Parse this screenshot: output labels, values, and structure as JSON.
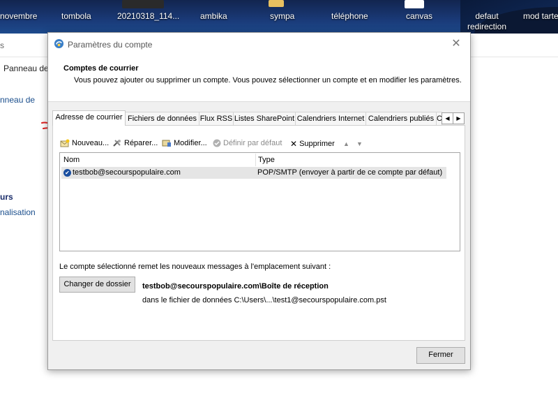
{
  "desktop": {
    "icons": [
      "novembre",
      "tombola",
      "20210318_114...",
      "ambika",
      "sympa",
      "téléphone",
      "canvas",
      "defaut redirection",
      "mod tarteaucit"
    ]
  },
  "background_window": {
    "top_left_fragment": "s",
    "breadcrumb_fragment": "Panneau de",
    "sidebar_fragment_1": "nneau de",
    "sidebar_fragment_2": "urs",
    "sidebar_fragment_3": "nalisation"
  },
  "dialog": {
    "title": "Paramètres du compte",
    "header_title": "Comptes de courrier",
    "header_subtitle": "Vous pouvez ajouter ou supprimer un compte. Vous pouvez sélectionner un compte et en modifier les paramètres.",
    "tabs": [
      "Adresse de courrier",
      "Fichiers de données",
      "Flux RSS",
      "Listes SharePoint",
      "Calendriers Internet",
      "Calendriers publiés",
      "C"
    ],
    "toolbar": {
      "new": "Nouveau...",
      "repair": "Réparer...",
      "modify": "Modifier...",
      "set_default": "Définir par défaut",
      "delete": "Supprimer"
    },
    "list": {
      "col_name": "Nom",
      "col_type": "Type",
      "rows": [
        {
          "name": "testbob@secourspopulaire.com",
          "type": "POP/SMTP (envoyer à partir de ce compte par défaut)"
        }
      ]
    },
    "delivery_info": "Le compte sélectionné remet les nouveaux messages à l'emplacement suivant :",
    "change_folder_button": "Changer de dossier",
    "delivery_path": "testbob@secourspopulaire.com\\Boîte de réception",
    "data_file_path": "dans le fichier de données C:\\Users\\...\\test1@secourspopulaire.com.pst",
    "close_button": "Fermer"
  },
  "colors": {
    "accent": "#1b4fa0",
    "annotation_red": "#e02020"
  }
}
